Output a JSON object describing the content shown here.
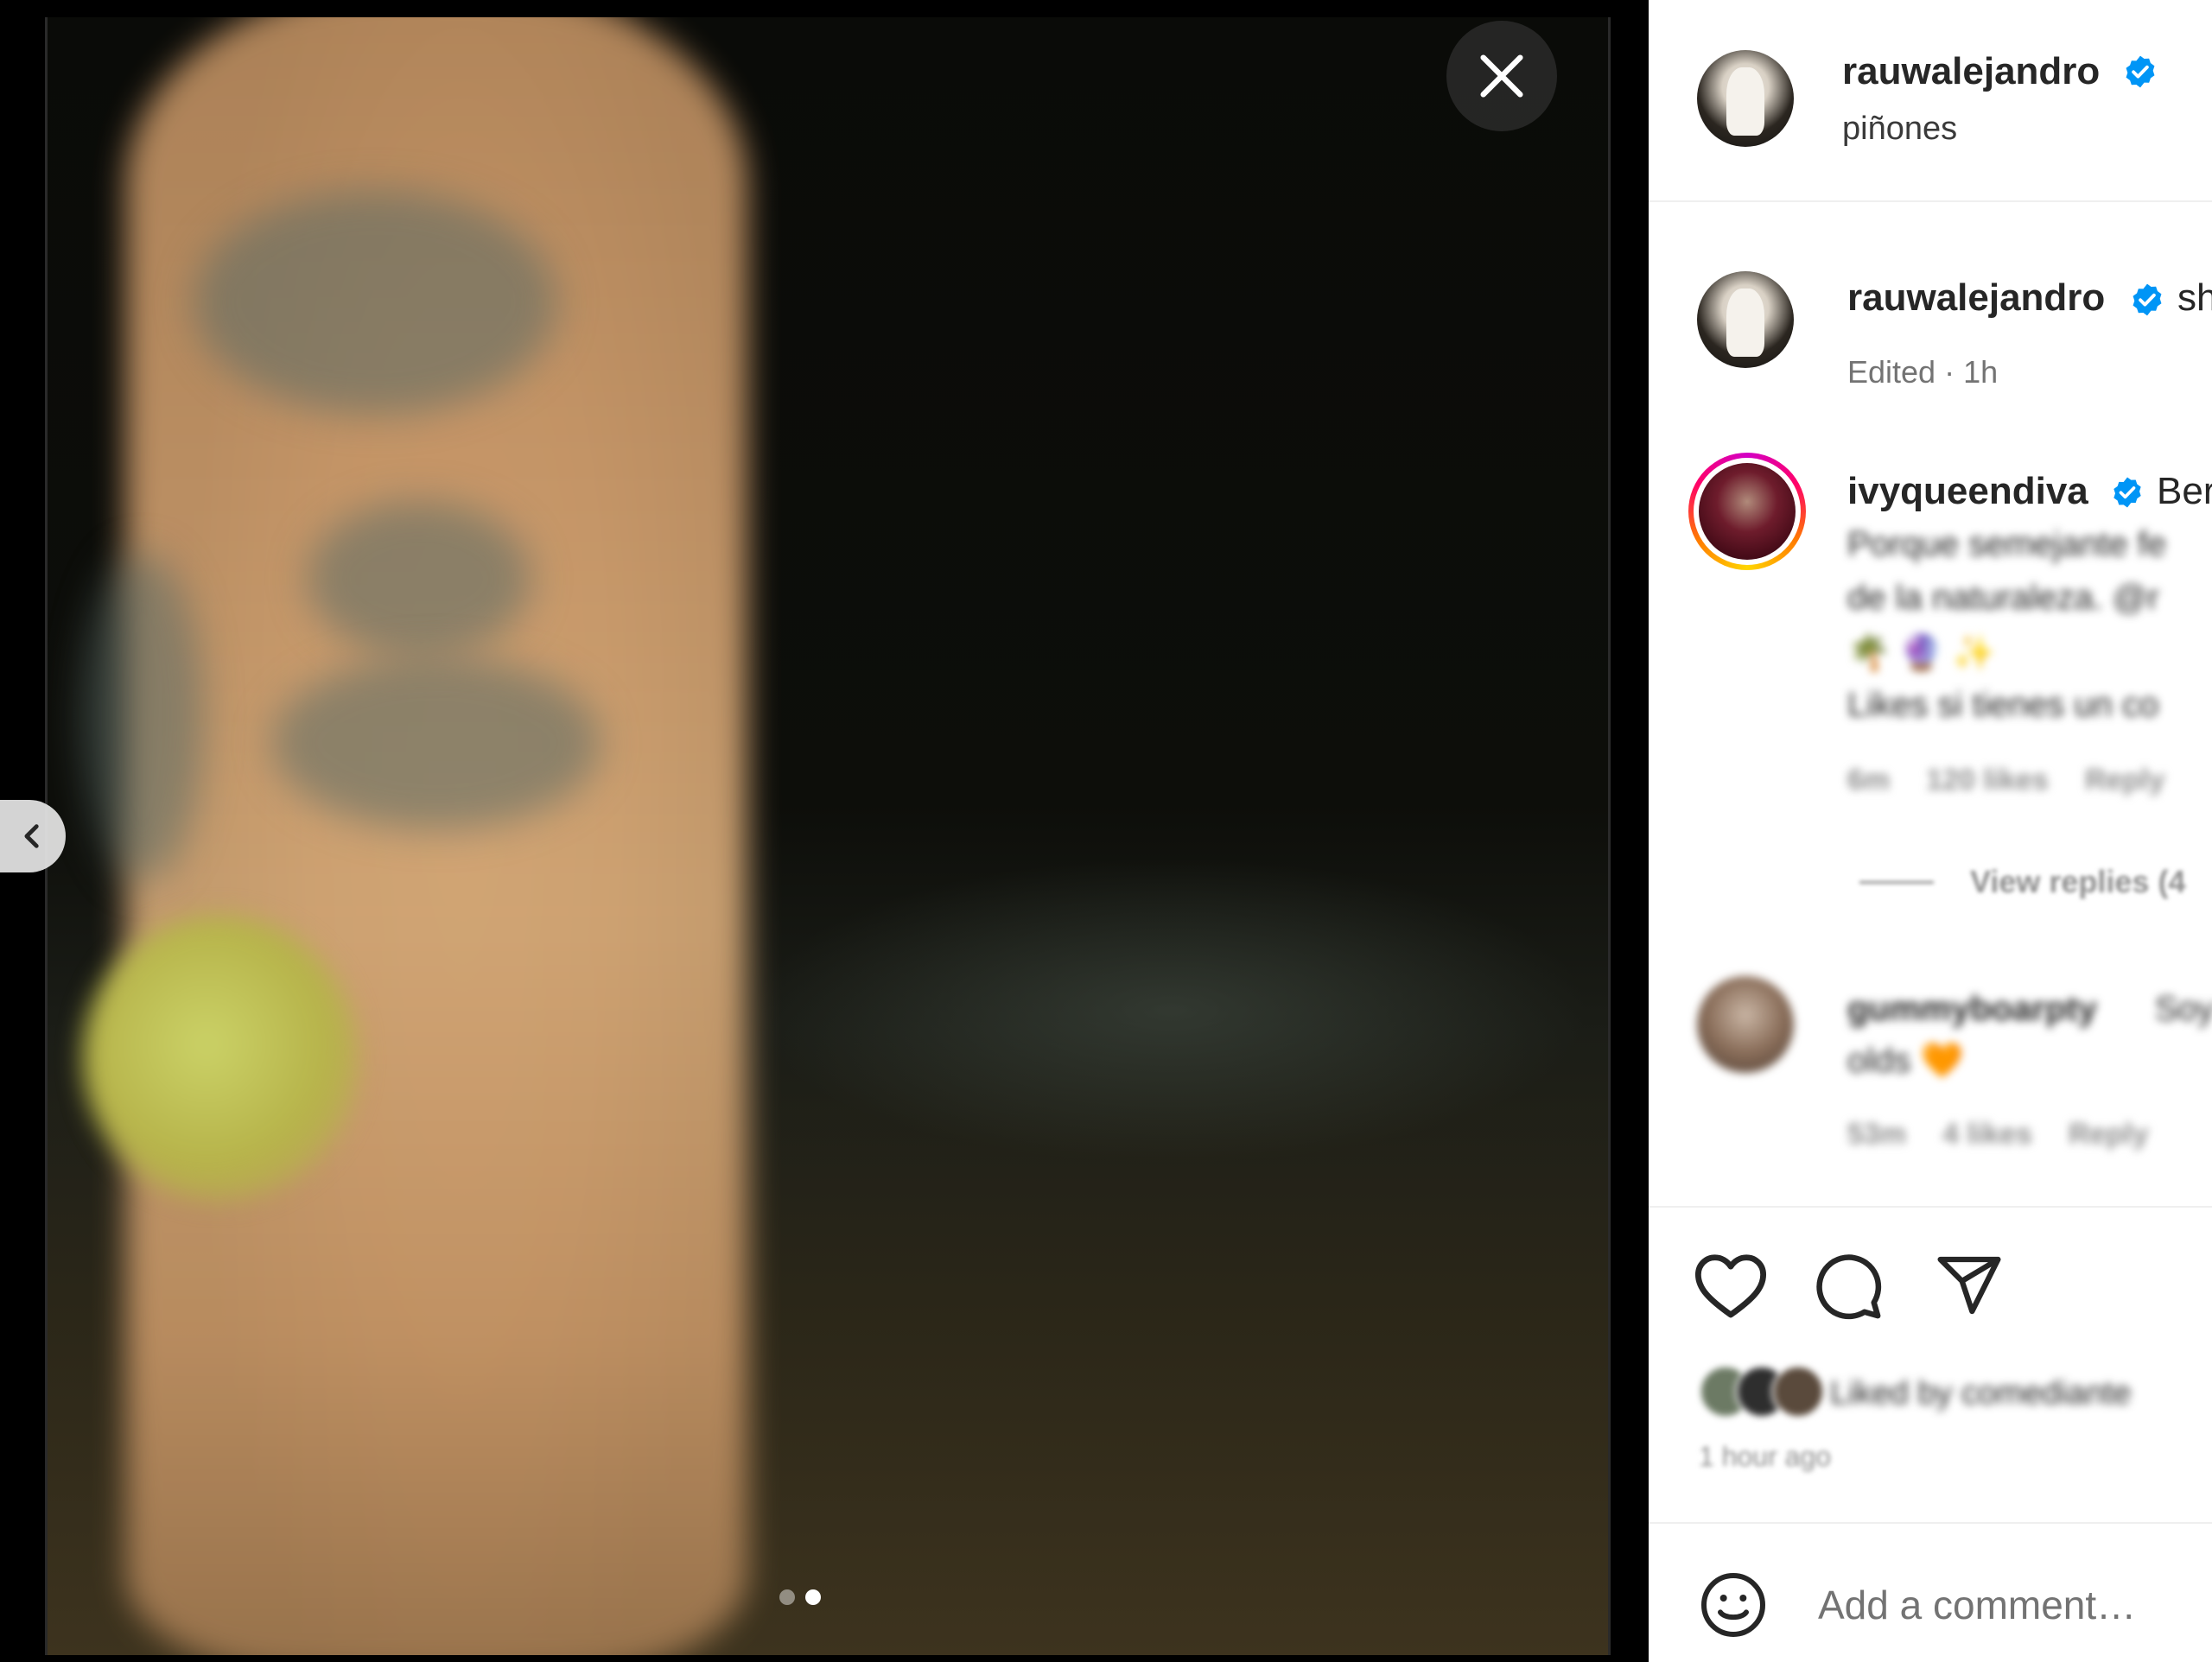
{
  "post_header": {
    "username": "rauwalejandro",
    "location": "piñones"
  },
  "caption": {
    "username": "rauwalejandro",
    "text_start": "sh",
    "meta": "Edited · 1h"
  },
  "top_comment": {
    "username": "ivyqueendiva",
    "text_start": "Ber",
    "lines": [
      "Porque semejante fe",
      "de la naturaleza. @r",
      "🌴 🔮 ✨",
      "Likes si tienes un co"
    ],
    "time": "6m",
    "likes": "120 likes",
    "reply": "Reply",
    "view_replies": "View replies (4"
  },
  "second_comment": {
    "username": "gummyboarpty",
    "text_start": "Soy",
    "line2": "olds 🧡",
    "time": "53m",
    "likes": "4 likes",
    "reply": "Reply"
  },
  "likes_summary": {
    "text": "Liked by comediante",
    "time": "1 hour ago"
  },
  "comment_box": {
    "placeholder": "Add a comment…"
  },
  "carousel": {
    "total": 2,
    "current": 2
  },
  "icons": {
    "close": "close-icon",
    "prev": "chevron-left-icon",
    "verified": "verified-badge-icon",
    "like": "heart-icon",
    "comment": "comment-icon",
    "share": "send-icon",
    "emoji": "emoji-icon"
  },
  "colors": {
    "verified_blue": "#0095f6",
    "text_primary": "#262626",
    "text_secondary": "#737373"
  }
}
